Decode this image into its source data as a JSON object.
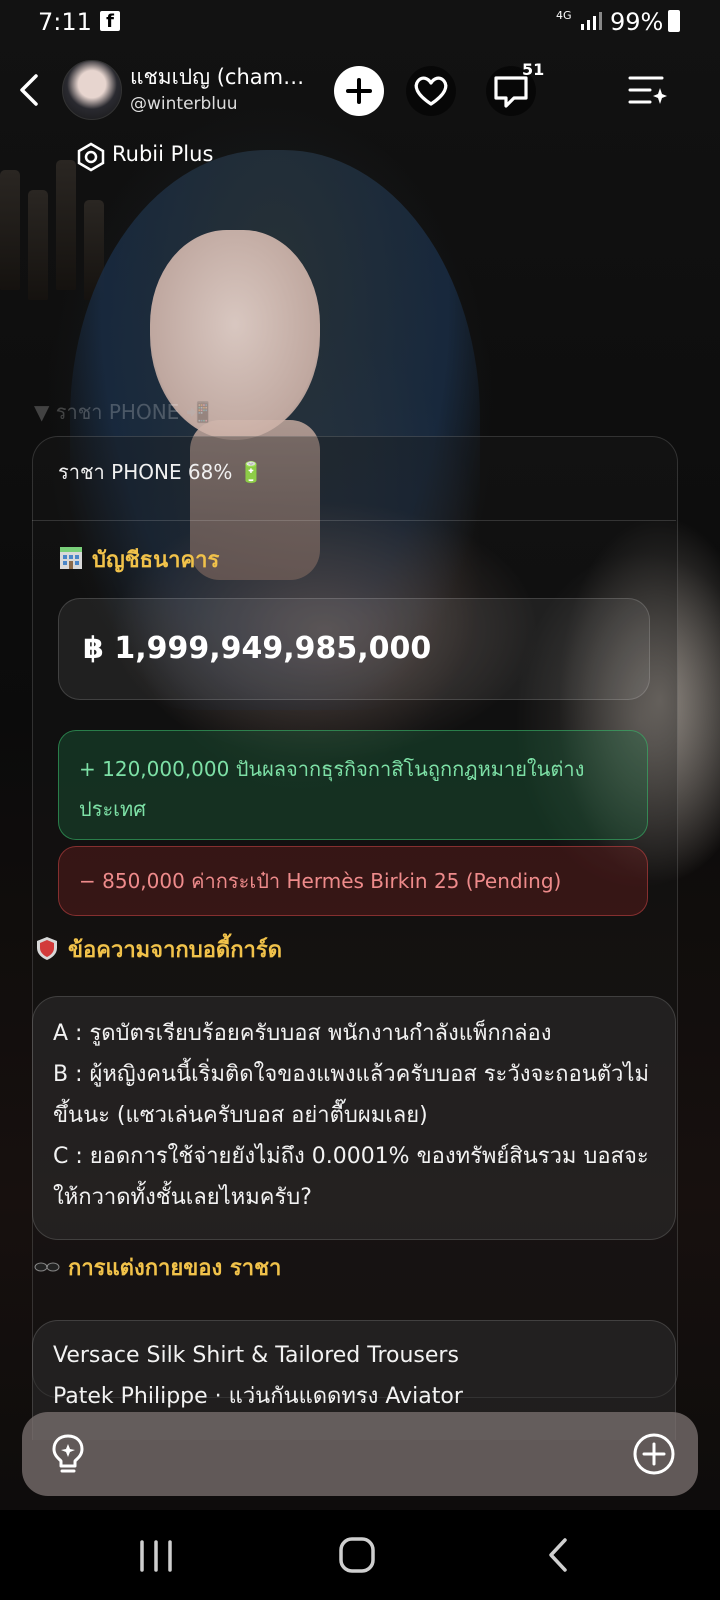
{
  "status_bar": {
    "time": "7:11",
    "network": "4G",
    "battery_text": "99%"
  },
  "header": {
    "character_name": "แชมเปญ (cham…",
    "handle": "@winterbluu",
    "comment_count": "51"
  },
  "badge": {
    "label": "Rubii Plus"
  },
  "ghost_text": "▼ ราชา PHONE 📲",
  "phone": {
    "header": "ราชา PHONE 68% 🔋",
    "bank": {
      "title": "บัญชีธนาคาร",
      "balance": "฿ 1,999,949,985,000"
    },
    "transactions": {
      "income": "+ 120,000,000 ปันผลจากธุรกิจกาสิโนถูกกฎหมายในต่างประเทศ",
      "expense": "− 850,000 ค่ากระเป๋า Hermès Birkin 25 (Pending)"
    },
    "bodyguard": {
      "title": "ข้อความจากบอดี้การ์ด",
      "messages": [
        "A : รูดบัตรเรียบร้อยครับบอส พนักงานกำลังแพ็กกล่อง",
        "B : ผู้หญิงคนนี้เริ่มติดใจของแพงแล้วครับบอส ระวังจะถอนตัวไม่ขึ้นนะ (แซวเล่นครับบอส อย่าตื๊บผมเลย)",
        "C : ยอดการใช้จ่ายยังไม่ถึง 0.0001% ของทรัพย์สินรวม บอสจะให้กวาดทั้งชั้นเลยไหมครับ?"
      ]
    },
    "outfit": {
      "title": "การแต่งกายของ ราชา",
      "lines": [
        "Versace Silk Shirt & Tailored Trousers",
        "Patek Philippe · แว่นกันแดดทรง Aviator"
      ]
    }
  },
  "colors": {
    "section_title": "#f1c24a",
    "income": "#7de0a6",
    "expense": "#ee8b8b"
  }
}
